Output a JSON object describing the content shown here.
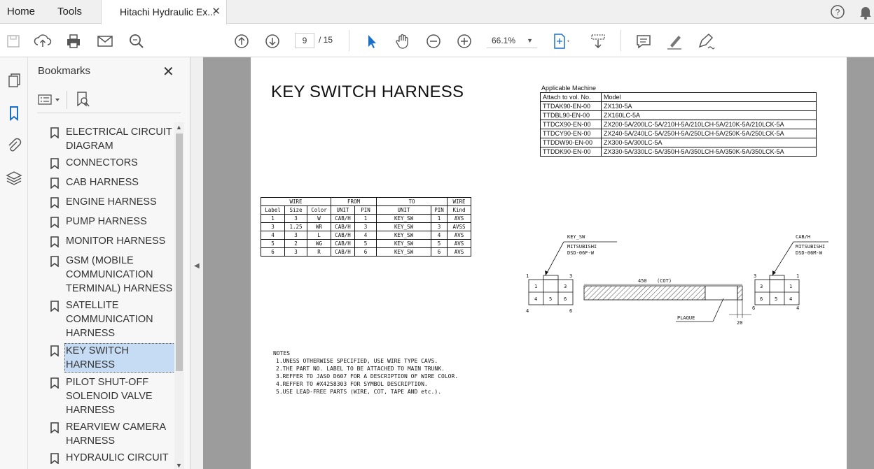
{
  "tabs": {
    "home": "Home",
    "tools": "Tools",
    "document": "Hitachi Hydraulic Ex...",
    "close": "✕"
  },
  "toolbar": {
    "current_page": "9",
    "total_pages": "/ 15",
    "zoom": "66.1%"
  },
  "bookmarks": {
    "title": "Bookmarks",
    "close": "✕",
    "items": [
      {
        "label": "ELECTRICAL CIRCUIT DIAGRAM"
      },
      {
        "label": "CONNECTORS"
      },
      {
        "label": "CAB HARNESS"
      },
      {
        "label": "ENGINE HARNESS"
      },
      {
        "label": "PUMP HARNESS"
      },
      {
        "label": "MONITOR HARNESS"
      },
      {
        "label": "GSM (MOBILE COMMUNICATION TERMINAL) HARNESS"
      },
      {
        "label": "SATELLITE COMMUNICATION HARNESS"
      },
      {
        "label": "KEY SWITCH HARNESS",
        "selected": true
      },
      {
        "label": "PILOT SHUT-OFF SOLENOID VALVE HARNESS"
      },
      {
        "label": "REARVIEW CAMERA HARNESS"
      },
      {
        "label": "HYDRAULIC CIRCUIT"
      }
    ]
  },
  "document": {
    "title": "KEY SWITCH HARNESS",
    "applicable": {
      "caption": "Applicable Machine",
      "headers": [
        "Attach to vol. No.",
        "Model"
      ],
      "rows": [
        [
          "TTDAK90-EN-00",
          "ZX130-5A"
        ],
        [
          "TTDBL90-EN-00",
          "ZX160LC-5A"
        ],
        [
          "TTDCX90-EN-00",
          "ZX200-5A/200LC-5A/210H-5A/210LCH-5A/210K-5A/210LCK-5A"
        ],
        [
          "TTDCY90-EN-00",
          "ZX240-5A/240LC-5A/250H-5A/250LCH-5A/250K-5A/250LCK-5A"
        ],
        [
          "TTDDW90-EN-00",
          "ZX300-5A/300LC-5A"
        ],
        [
          "TTDDK90-EN-00",
          "ZX330-5A/330LC-5A/350H-5A/350LCH-5A/350K-5A/350LCK-5A"
        ]
      ]
    },
    "wire_table": {
      "group_headers": [
        "WIRE",
        "FROM",
        "TO",
        "WIRE"
      ],
      "headers": [
        "Label",
        "Size",
        "Color",
        "UNIT",
        "PIN",
        "UNIT",
        "PIN",
        "Kind"
      ],
      "rows": [
        [
          "1",
          "3",
          "W",
          "CAB/H",
          "1",
          "KEY_SW",
          "1",
          "AVS"
        ],
        [
          "3",
          "1.25",
          "WR",
          "CAB/H",
          "3",
          "KEY_SW",
          "3",
          "AVSS"
        ],
        [
          "4",
          "3",
          "L",
          "CAB/H",
          "4",
          "KEY_SW",
          "4",
          "AVS"
        ],
        [
          "5",
          "2",
          "WG",
          "CAB/H",
          "5",
          "KEY_SW",
          "5",
          "AVS"
        ],
        [
          "6",
          "3",
          "R",
          "CAB/H",
          "6",
          "KEY_SW",
          "6",
          "AVS"
        ]
      ]
    },
    "diagram": {
      "left_connector_name": "KEY_SW",
      "left_connector_maker": "MITSUBISHI",
      "left_connector_part": "DSD-06F-W",
      "right_connector_name": "CAB/H",
      "right_connector_maker": "MITSUBISHI",
      "right_connector_part": "DSD-06M-W",
      "length_label": "450",
      "length_note": "(COT)",
      "plaque_label": "PLAQUE",
      "end_dim": "20",
      "left_top_row": [
        "1",
        "",
        "3"
      ],
      "left_bottom_row": [
        "4",
        "5",
        "6"
      ],
      "right_top_row": [
        "3",
        "",
        "1"
      ],
      "right_bottom_row": [
        "6",
        "5",
        "4"
      ],
      "pin_marks_left": [
        "1",
        "3",
        "4",
        "6"
      ],
      "pin_marks_right": [
        "3",
        "1",
        "6",
        "4"
      ]
    },
    "notes": {
      "heading": "NOTES",
      "lines": [
        "1.UNESS OTHERWISE SPECIFIED, USE WIRE TYPE CAVS.",
        "2.THE PART NO. LABEL TO BE ATTACHED TO MAIN TRUNK.",
        "3.REFFER TO JASO D607 FOR A DESCRIPTION OF WIRE COLOR.",
        "4.REFFER TO #X4258303 FOR SYMBOL DESCRIPTION.",
        "5.USE LEAD-FREE PARTS (WIRE, COT, TAPE AND etc.)."
      ]
    }
  }
}
